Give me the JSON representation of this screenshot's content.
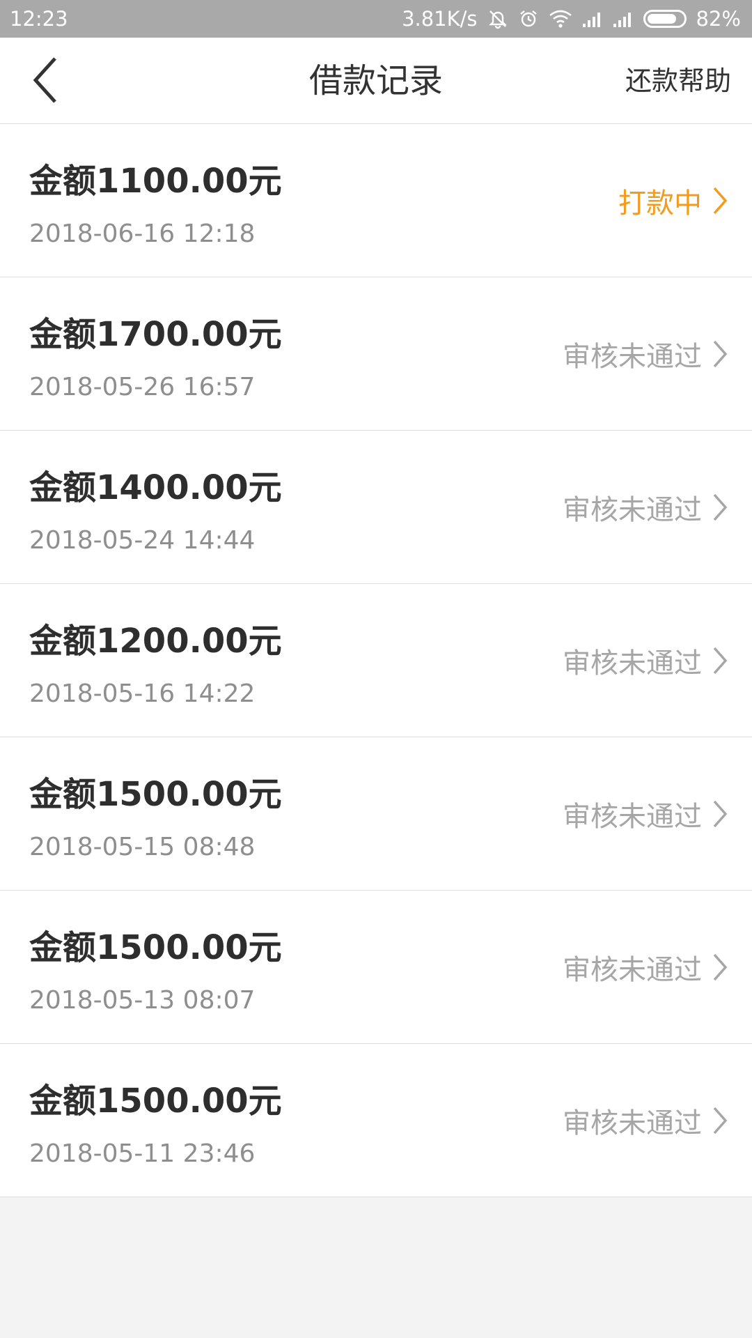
{
  "status_bar": {
    "time": "12:23",
    "net_speed": "3.81K/s",
    "battery": "82%",
    "battery_level": 0.82,
    "icons": [
      "mute-icon",
      "alarm-icon",
      "wifi-icon",
      "signal-icon",
      "signal-icon",
      "battery-icon"
    ]
  },
  "navbar": {
    "back_icon": "back-chevron-icon",
    "title": "借款记录",
    "help_label": "还款帮助"
  },
  "colors": {
    "pending": "#f39b1c",
    "rejected": "#a6a6a6",
    "amount": "#2e2e2e",
    "date": "#8e8e8e"
  },
  "records": [
    {
      "amount": "金额1100.00元",
      "date": "2018-06-16 12:18",
      "status": "打款中",
      "state": "pending"
    },
    {
      "amount": "金额1700.00元",
      "date": "2018-05-26 16:57",
      "status": "审核未通过",
      "state": "rejected"
    },
    {
      "amount": "金额1400.00元",
      "date": "2018-05-24 14:44",
      "status": "审核未通过",
      "state": "rejected"
    },
    {
      "amount": "金额1200.00元",
      "date": "2018-05-16 14:22",
      "status": "审核未通过",
      "state": "rejected"
    },
    {
      "amount": "金额1500.00元",
      "date": "2018-05-15 08:48",
      "status": "审核未通过",
      "state": "rejected"
    },
    {
      "amount": "金额1500.00元",
      "date": "2018-05-13 08:07",
      "status": "审核未通过",
      "state": "rejected"
    },
    {
      "amount": "金额1500.00元",
      "date": "2018-05-11 23:46",
      "status": "审核未通过",
      "state": "rejected"
    }
  ]
}
